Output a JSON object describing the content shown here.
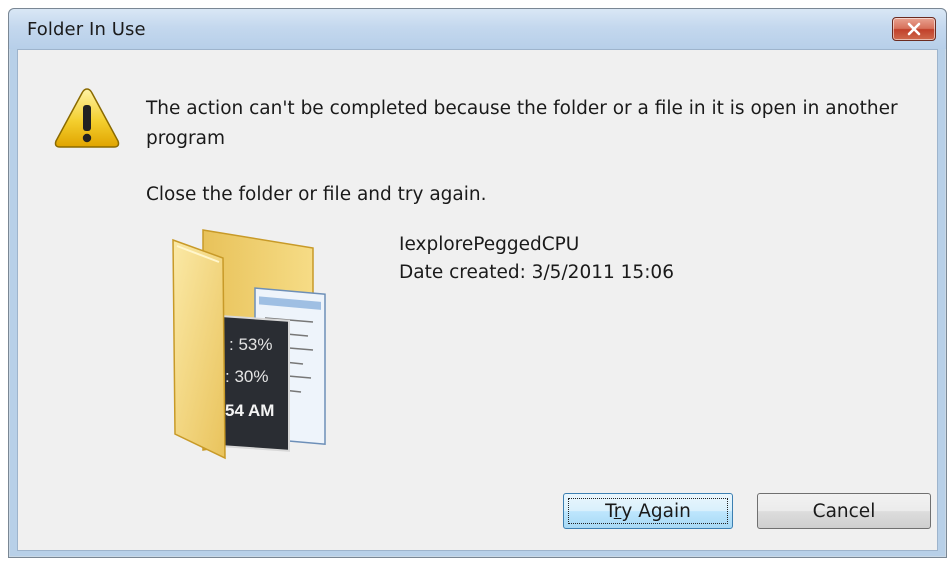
{
  "dialog": {
    "title": "Folder In Use",
    "message": "The action can't be completed because the folder or a file in it is open in another program",
    "instruction": "Close the folder or file and try again.",
    "file": {
      "name": "IexplorePeggedCPU",
      "date_created": "Date created: 3/5/2011 15:06"
    },
    "buttons": {
      "try_again_pre": "T",
      "try_again_ul": "r",
      "try_again_post": "y Again",
      "cancel": "Cancel"
    },
    "thumbnail_text": {
      "line1": ": 53%",
      "line2": ": 30%",
      "line3": "54 AM"
    }
  },
  "colors": {
    "title_bar": "#c4d8ee",
    "close_button": "#c9533c",
    "client_bg": "#f0f0f0",
    "default_button": "#bee6fd"
  },
  "icons": {
    "warning": "warning-icon",
    "close": "close-icon",
    "folder": "folder-icon"
  }
}
